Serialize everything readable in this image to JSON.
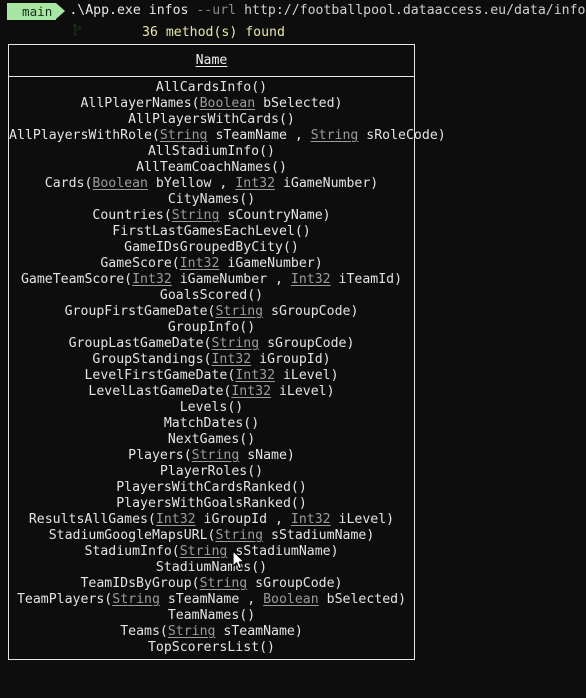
{
  "terminal": {
    "prompt": {
      "branch_badge": "main",
      "branch_icon": "git-branch-icon",
      "executable": ".\\App.exe",
      "subcommand": "infos",
      "flag": "--url",
      "url": "http://footballpool.dataaccess.eu/data/info.wso?wsdl"
    },
    "status_line": "36 method(s) found",
    "table": {
      "header": "Name",
      "rows": [
        [
          {
            "t": "AllCardsInfo()"
          }
        ],
        [
          {
            "t": "AllPlayerNames("
          },
          {
            "t": "Boolean",
            "k": "type"
          },
          {
            "t": " bSelected)"
          }
        ],
        [
          {
            "t": "AllPlayersWithCards()"
          }
        ],
        [
          {
            "t": "AllPlayersWithRole("
          },
          {
            "t": "String",
            "k": "type"
          },
          {
            "t": " sTeamName , "
          },
          {
            "t": "String",
            "k": "type"
          },
          {
            "t": " sRoleCode)"
          }
        ],
        [
          {
            "t": "AllStadiumInfo()"
          }
        ],
        [
          {
            "t": "AllTeamCoachNames()"
          }
        ],
        [
          {
            "t": "Cards("
          },
          {
            "t": "Boolean",
            "k": "type"
          },
          {
            "t": " bYellow , "
          },
          {
            "t": "Int32",
            "k": "type"
          },
          {
            "t": " iGameNumber)"
          }
        ],
        [
          {
            "t": "CityNames()"
          }
        ],
        [
          {
            "t": "Countries("
          },
          {
            "t": "String",
            "k": "type"
          },
          {
            "t": " sCountryName)"
          }
        ],
        [
          {
            "t": "FirstLastGamesEachLevel()"
          }
        ],
        [
          {
            "t": "GameIDsGroupedByCity()"
          }
        ],
        [
          {
            "t": "GameScore("
          },
          {
            "t": "Int32",
            "k": "type"
          },
          {
            "t": " iGameNumber)"
          }
        ],
        [
          {
            "t": "GameTeamScore("
          },
          {
            "t": "Int32",
            "k": "type"
          },
          {
            "t": " iGameNumber , "
          },
          {
            "t": "Int32",
            "k": "type"
          },
          {
            "t": " iTeamId)"
          }
        ],
        [
          {
            "t": "GoalsScored()"
          }
        ],
        [
          {
            "t": "GroupFirstGameDate("
          },
          {
            "t": "String",
            "k": "type"
          },
          {
            "t": " sGroupCode)"
          }
        ],
        [
          {
            "t": "GroupInfo()"
          }
        ],
        [
          {
            "t": "GroupLastGameDate("
          },
          {
            "t": "String",
            "k": "type"
          },
          {
            "t": " sGroupCode)"
          }
        ],
        [
          {
            "t": "GroupStandings("
          },
          {
            "t": "Int32",
            "k": "type"
          },
          {
            "t": " iGroupId)"
          }
        ],
        [
          {
            "t": "LevelFirstGameDate("
          },
          {
            "t": "Int32",
            "k": "type"
          },
          {
            "t": " iLevel)"
          }
        ],
        [
          {
            "t": "LevelLastGameDate("
          },
          {
            "t": "Int32",
            "k": "type"
          },
          {
            "t": " iLevel)"
          }
        ],
        [
          {
            "t": "Levels()"
          }
        ],
        [
          {
            "t": "MatchDates()"
          }
        ],
        [
          {
            "t": "NextGames()"
          }
        ],
        [
          {
            "t": "Players("
          },
          {
            "t": "String",
            "k": "type"
          },
          {
            "t": " sName)"
          }
        ],
        [
          {
            "t": "PlayerRoles()"
          }
        ],
        [
          {
            "t": "PlayersWithCardsRanked()"
          }
        ],
        [
          {
            "t": "PlayersWithGoalsRanked()"
          }
        ],
        [
          {
            "t": "ResultsAllGames("
          },
          {
            "t": "Int32",
            "k": "type"
          },
          {
            "t": " iGroupId , "
          },
          {
            "t": "Int32",
            "k": "type"
          },
          {
            "t": " iLevel)"
          }
        ],
        [
          {
            "t": "StadiumGoogleMapsURL("
          },
          {
            "t": "String",
            "k": "type"
          },
          {
            "t": " sStadiumName)"
          }
        ],
        [
          {
            "t": "StadiumInfo("
          },
          {
            "t": "String",
            "k": "type"
          },
          {
            "t": " sStadiumName)"
          }
        ],
        [
          {
            "t": "StadiumNames()"
          }
        ],
        [
          {
            "t": "TeamIDsByGroup("
          },
          {
            "t": "String",
            "k": "type"
          },
          {
            "t": " sGroupCode)"
          }
        ],
        [
          {
            "t": "TeamPlayers("
          },
          {
            "t": "String",
            "k": "type"
          },
          {
            "t": " sTeamName , "
          },
          {
            "t": "Boolean",
            "k": "type"
          },
          {
            "t": " bSelected)"
          }
        ],
        [
          {
            "t": "TeamNames()"
          }
        ],
        [
          {
            "t": "Teams("
          },
          {
            "t": "String",
            "k": "type"
          },
          {
            "t": " sTeamName)"
          }
        ],
        [
          {
            "t": "TopScorersList()"
          }
        ]
      ]
    },
    "colors": {
      "background": "#0d0d0d",
      "branch_badge_bg": "#a9e6a4",
      "branch_badge_fg": "#16311a",
      "status_text": "#e9e6a8",
      "border": "#e6e6e6",
      "method_text": "#e4e4e4",
      "type_text": "#9b9b9b",
      "flag_text": "#8a8a8a"
    }
  }
}
